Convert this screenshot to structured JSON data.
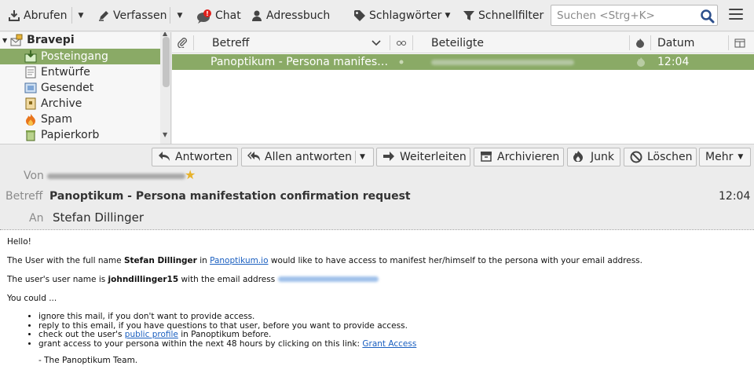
{
  "toolbar": {
    "fetch_label": "Abrufen",
    "compose_label": "Verfassen",
    "chat_label": "Chat",
    "addressbook_label": "Adressbuch",
    "tags_label": "Schlagwörter",
    "quickfilter_label": "Schnellfilter",
    "search_placeholder": "Suchen <Strg+K>"
  },
  "folders": {
    "account": "Bravepi",
    "items": [
      {
        "label": "Posteingang",
        "icon": "inbox-icon",
        "selected": true
      },
      {
        "label": "Entwürfe",
        "icon": "drafts-icon"
      },
      {
        "label": "Gesendet",
        "icon": "sent-icon"
      },
      {
        "label": "Archive",
        "icon": "archive-folder-icon"
      },
      {
        "label": "Spam",
        "icon": "spam-icon"
      },
      {
        "label": "Papierkorb",
        "icon": "trash-icon"
      }
    ]
  },
  "thread_list": {
    "columns": {
      "subject": "Betreff",
      "participants": "Beteiligte",
      "date": "Datum"
    },
    "rows": [
      {
        "subject": "Panoptikum - Persona manifes…",
        "date": "12:04"
      }
    ]
  },
  "actions": {
    "reply": "Antworten",
    "reply_all": "Allen antworten",
    "forward": "Weiterleiten",
    "archive": "Archivieren",
    "junk": "Junk",
    "delete": "Löschen",
    "more": "Mehr"
  },
  "header": {
    "from_label": "Von",
    "subject_label": "Betreff",
    "subject": "Panoptikum - Persona manifestation confirmation request",
    "time": "12:04",
    "to_label": "An",
    "to": "Stefan Dillinger"
  },
  "body": {
    "greeting": "Hello!",
    "line1_pre": "The User with the full name ",
    "line1_name": "Stefan Dillinger",
    "line1_mid": " in ",
    "line1_link": "Panoptikum.io",
    "line1_post": " would like to have access to manifest her/himself to the persona with your email address.",
    "line2_pre": "The user's user name is ",
    "line2_user": "johndillinger15",
    "line2_post": " with the email address",
    "line3": "You could ...",
    "bullet1": "ignore this mail, if you don't want to provide access.",
    "bullet2": "reply to this email, if you have questions to that user, before you want to provide access.",
    "bullet3_pre": "check out the user's ",
    "bullet3_link": "public profile",
    "bullet3_post": " in Panoptikum before.",
    "bullet4_pre": "grant access to your persona within the next 48 hours by clicking on this link: ",
    "bullet4_link": "Grant Access",
    "signature": "- The Panoptikum Team."
  },
  "colors": {
    "selection": "#8aaa66",
    "link": "#1a5fc0",
    "chat_badge": "#e0201b"
  }
}
